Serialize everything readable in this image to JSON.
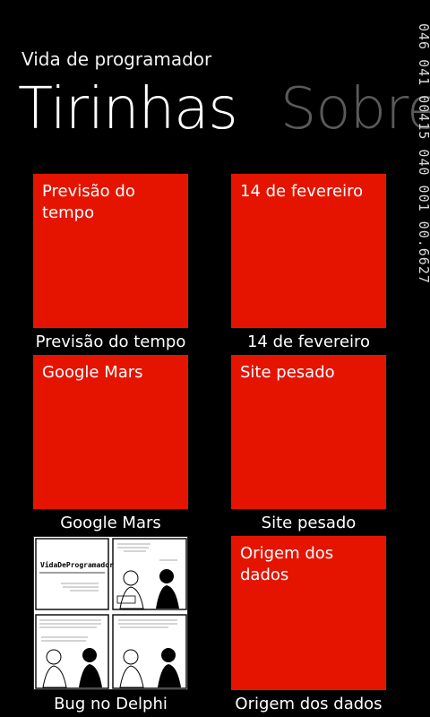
{
  "app": {
    "title": "Vida de programador"
  },
  "pivot": {
    "active": "Tirinhas",
    "next": "Sobre"
  },
  "debug_counter": "046 041 00415 040 001 00.6627",
  "tiles": [
    {
      "tile_text": "Previsão do tempo",
      "caption": "Previsão do tempo",
      "kind": "red"
    },
    {
      "tile_text": "14 de fevereiro",
      "caption": "14 de fevereiro",
      "kind": "red"
    },
    {
      "tile_text": "Google Mars",
      "caption": "Google Mars",
      "kind": "red"
    },
    {
      "tile_text": "Site pesado",
      "caption": "Site pesado",
      "kind": "red"
    },
    {
      "tile_text": "",
      "caption": "Bug no Delphi",
      "kind": "comic-image",
      "comic_logo": "VidaDeProgramador"
    },
    {
      "tile_text": "Origem dos dados",
      "caption": "Origem dos dados",
      "kind": "red"
    }
  ],
  "colors": {
    "accent": "#e51400",
    "background": "#000000",
    "inactive_header": "#5a5a5a"
  }
}
